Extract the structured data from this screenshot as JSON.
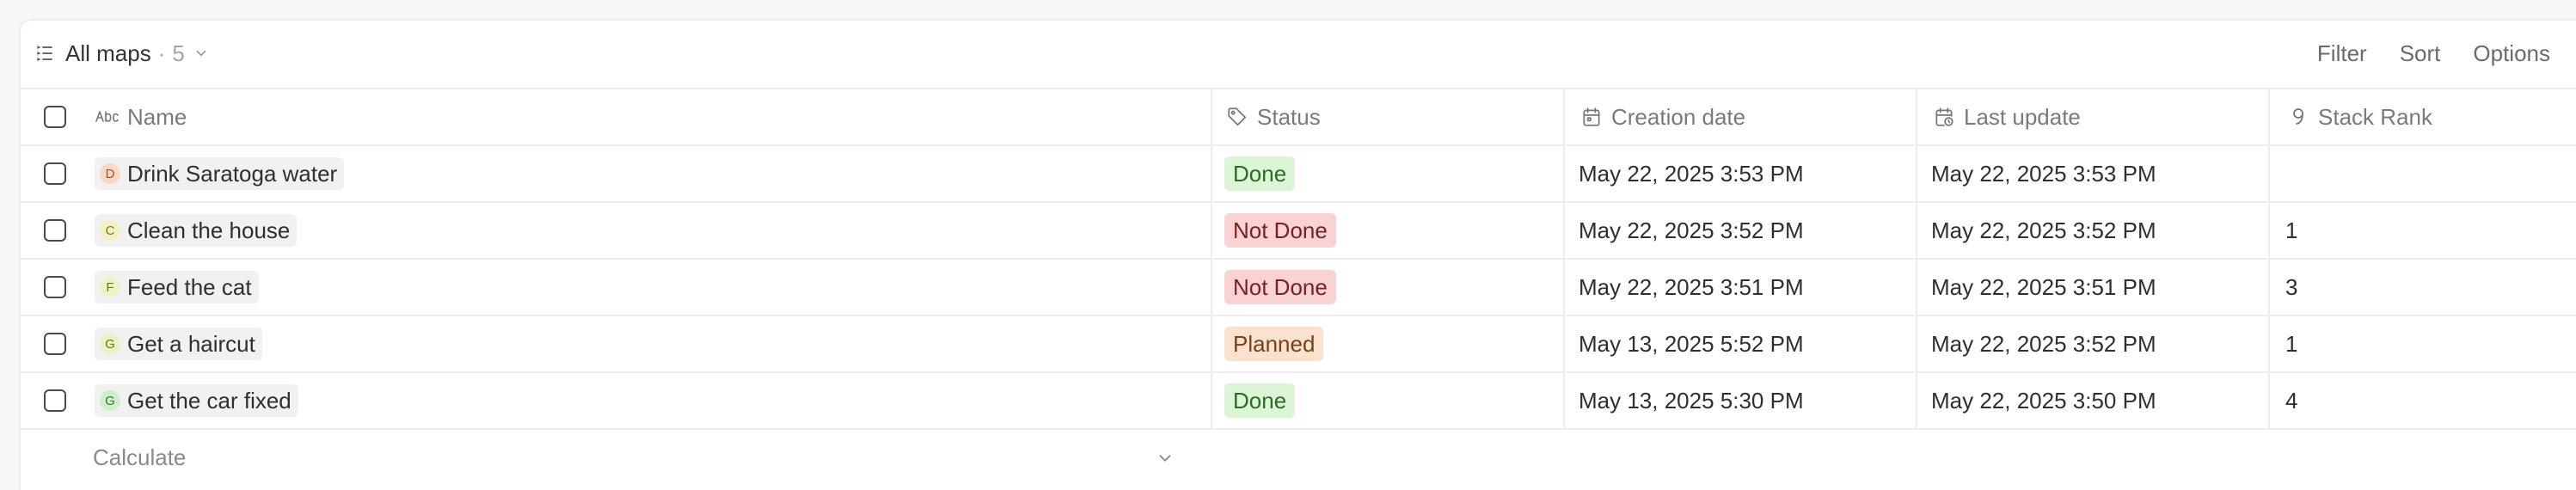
{
  "toolbar": {
    "view_title": "All maps",
    "view_separator": "·",
    "view_count": "5",
    "actions": {
      "filter": "Filter",
      "sort": "Sort",
      "options": "Options"
    }
  },
  "columns": {
    "name": "Name",
    "status": "Status",
    "creation_date": "Creation date",
    "last_update": "Last update",
    "stack_rank": "Stack Rank"
  },
  "icons": {
    "view": "list-icon",
    "name": "text-abc-icon",
    "status": "tag-icon",
    "creation_date": "calendar-icon",
    "last_update": "calendar-clock-icon",
    "stack_rank": "number-icon"
  },
  "status_colors": {
    "Done": {
      "bg": "#dcf5d7",
      "fg": "#2e6b24"
    },
    "Not Done": {
      "bg": "#f9d3d3",
      "fg": "#7a2222"
    },
    "Planned": {
      "bg": "#fbe2cf",
      "fg": "#7a3f14"
    }
  },
  "rows": [
    {
      "avatar": "D",
      "avatar_bg": "#f9d9c6",
      "avatar_fg": "#a0552a",
      "name": "Drink Saratoga water",
      "status": "Done",
      "creation_date": "May 22, 2025 3:53 PM",
      "last_update": "May 22, 2025 3:53 PM",
      "stack_rank": ""
    },
    {
      "avatar": "C",
      "avatar_bg": "#f3f1c4",
      "avatar_fg": "#7c7420",
      "name": "Clean the house",
      "status": "Not Done",
      "creation_date": "May 22, 2025 3:52 PM",
      "last_update": "May 22, 2025 3:52 PM",
      "stack_rank": "1"
    },
    {
      "avatar": "F",
      "avatar_bg": "#eff2c6",
      "avatar_fg": "#6f7a1e",
      "name": "Feed the cat",
      "status": "Not Done",
      "creation_date": "May 22, 2025 3:51 PM",
      "last_update": "May 22, 2025 3:51 PM",
      "stack_rank": "3"
    },
    {
      "avatar": "G",
      "avatar_bg": "#eaf2c4",
      "avatar_fg": "#5e7a1e",
      "name": "Get a haircut",
      "status": "Planned",
      "creation_date": "May 13, 2025 5:52 PM",
      "last_update": "May 22, 2025 3:52 PM",
      "stack_rank": "1"
    },
    {
      "avatar": "G",
      "avatar_bg": "#cdefcb",
      "avatar_fg": "#2f7a2c",
      "name": "Get the car fixed",
      "status": "Done",
      "creation_date": "May 13, 2025 5:30 PM",
      "last_update": "May 22, 2025 3:50 PM",
      "stack_rank": "4"
    }
  ],
  "footer": {
    "calculate_label": "Calculate"
  }
}
